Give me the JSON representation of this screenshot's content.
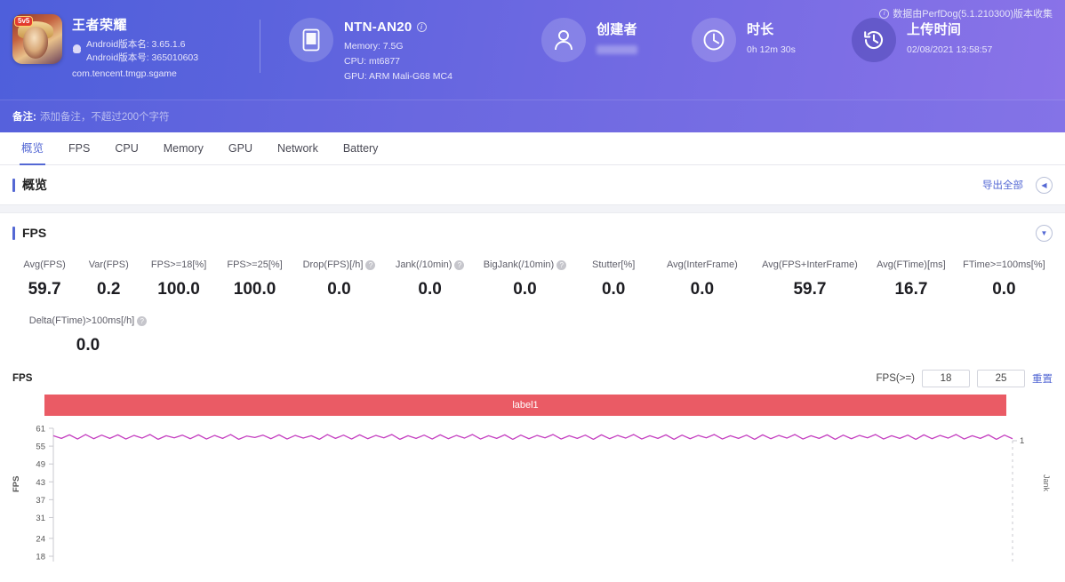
{
  "header": {
    "source_note": "数据由PerfDog(5.1.210300)版本收集",
    "info_icon": "info-icon",
    "game": {
      "badge": "5v5",
      "title": "王者荣耀",
      "version_name": "Android版本名: 3.65.1.6",
      "version_code": "Android版本号: 365010603",
      "package": "com.tencent.tmgp.sgame"
    },
    "device": {
      "name": "NTN-AN20",
      "memory": "Memory: 7.5G",
      "cpu": "CPU: mt6877",
      "gpu": "GPU: ARM Mali-G68 MC4"
    },
    "creator": {
      "title": "创建者",
      "value": ""
    },
    "duration": {
      "title": "时长",
      "value": "0h 12m 30s"
    },
    "upload": {
      "title": "上传时间",
      "value": "02/08/2021 13:58:57"
    }
  },
  "remark": {
    "label": "备注:",
    "placeholder": "添加备注，不超过200个字符",
    "value": ""
  },
  "tabs": [
    {
      "label": "概览",
      "active": true
    },
    {
      "label": "FPS",
      "active": false
    },
    {
      "label": "CPU",
      "active": false
    },
    {
      "label": "Memory",
      "active": false
    },
    {
      "label": "GPU",
      "active": false
    },
    {
      "label": "Network",
      "active": false
    },
    {
      "label": "Battery",
      "active": false
    }
  ],
  "overview": {
    "title": "概览",
    "export_label": "导出全部",
    "collapse_icon": "chevron-left-icon"
  },
  "fps_section": {
    "title": "FPS",
    "expand_icon": "chevron-down-icon"
  },
  "metrics_row1": [
    {
      "label": "Avg(FPS)",
      "value": "59.7",
      "help": false
    },
    {
      "label": "Var(FPS)",
      "value": "0.2",
      "help": false
    },
    {
      "label": "FPS>=18[%]",
      "value": "100.0",
      "help": false
    },
    {
      "label": "FPS>=25[%]",
      "value": "100.0",
      "help": false
    },
    {
      "label": "Drop(FPS)[/h]",
      "value": "0.0",
      "help": true
    },
    {
      "label": "Jank(/10min)",
      "value": "0.0",
      "help": true
    },
    {
      "label": "BigJank(/10min)",
      "value": "0.0",
      "help": true
    },
    {
      "label": "Stutter[%]",
      "value": "0.0",
      "help": false
    },
    {
      "label": "Avg(InterFrame)",
      "value": "0.0",
      "help": false
    },
    {
      "label": "Avg(FPS+InterFrame)",
      "value": "59.7",
      "help": false
    },
    {
      "label": "Avg(FTime)[ms]",
      "value": "16.7",
      "help": false
    },
    {
      "label": "FTime>=100ms[%]",
      "value": "0.0",
      "help": false
    }
  ],
  "metrics_row2": [
    {
      "label": "Delta(FTime)>100ms[/h]",
      "value": "0.0",
      "help": true
    }
  ],
  "chart_controls": {
    "axis_title": "FPS",
    "fps_label": "FPS(>=)",
    "threshold_low": "18",
    "threshold_high": "25",
    "reset_label": "重置"
  },
  "chart_data": {
    "type": "line",
    "title": "FPS",
    "legend": [
      "label1"
    ],
    "legend_color": "#ea5b65",
    "series": [
      {
        "name": "label1",
        "color": "#c43fc0",
        "values": [
          58.5,
          57.6,
          58.8,
          57.4,
          58.9,
          57.5,
          58.7,
          57.6,
          58.8,
          57.4,
          58.6,
          57.7,
          58.9,
          57.3,
          58.5,
          57.8,
          58.7,
          57.5,
          58.8,
          57.4,
          58.6,
          57.6,
          58.9,
          57.3,
          58.4,
          57.9,
          58.7,
          57.5,
          58.8,
          57.4,
          58.6,
          57.7,
          58.5,
          57.3,
          58.9,
          57.6,
          58.7,
          57.4,
          58.8,
          57.5,
          58.6,
          57.8,
          58.9,
          57.3,
          58.5,
          57.6,
          58.7,
          57.4,
          58.8,
          57.5,
          58.6,
          57.7,
          58.9,
          57.4,
          58.5,
          57.6,
          58.8,
          57.3,
          58.7,
          57.5,
          58.6,
          57.8,
          58.9,
          57.4,
          58.5,
          57.6,
          58.7,
          57.3,
          58.8,
          57.5,
          58.6,
          57.7,
          58.9,
          57.4,
          58.5,
          57.6,
          58.8,
          57.3,
          58.7,
          57.5,
          58.6,
          57.8,
          58.9,
          57.4,
          58.5,
          57.6,
          58.7,
          57.3,
          58.8,
          57.5,
          58.6,
          57.7,
          58.9,
          57.4,
          58.5,
          57.6,
          58.8,
          57.3,
          58.7,
          57.5,
          58.6,
          57.8,
          58.9,
          57.4,
          58.5,
          57.6,
          58.7,
          57.3,
          58.8,
          57.5,
          58.6,
          57.7,
          58.9,
          57.4,
          58.5,
          57.6,
          58.8,
          57.3,
          58.7,
          57.5
        ]
      }
    ],
    "ylabel": "FPS",
    "yticks": [
      61,
      55,
      49,
      43,
      37,
      31,
      24,
      18
    ],
    "ylim": [
      18,
      61
    ],
    "y2label": "Jank",
    "y2ticks": [
      1
    ],
    "y2lim": [
      0,
      1
    ],
    "grid": false
  }
}
